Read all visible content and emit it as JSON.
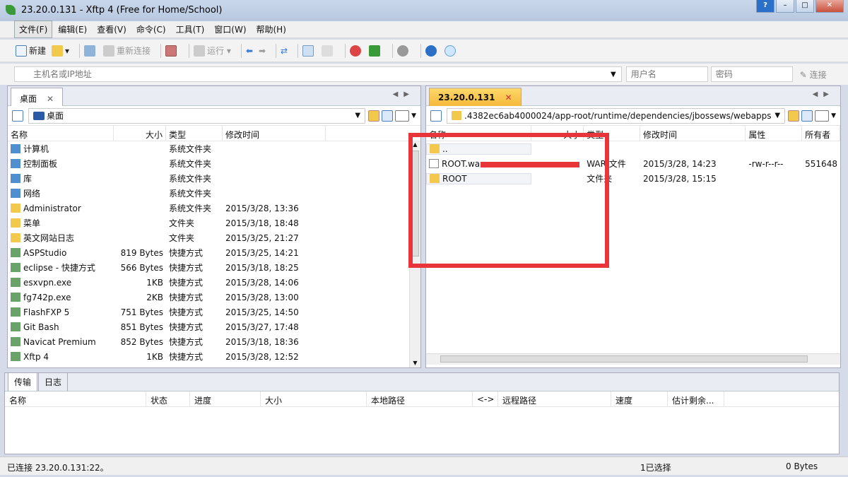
{
  "window": {
    "title": "23.20.0.131 - Xftp 4 (Free for Home/School)"
  },
  "menu": [
    "文件(F)",
    "编辑(E)",
    "查看(V)",
    "命令(C)",
    "工具(T)",
    "窗口(W)",
    "帮助(H)"
  ],
  "toolbar": {
    "new": "新建",
    "reconnect": "重新连接",
    "run": "运行"
  },
  "address": {
    "host_placeholder": "主机名或IP地址",
    "user_placeholder": "用户名",
    "password_placeholder": "密码",
    "connect": "连接"
  },
  "left": {
    "tab": "桌面",
    "path": "桌面",
    "columns": [
      "名称",
      "大小",
      "类型",
      "修改时间"
    ],
    "rows": [
      {
        "name": "计算机",
        "size": "",
        "type": "系统文件夹",
        "time": "",
        "icon": "sys"
      },
      {
        "name": "控制面板",
        "size": "",
        "type": "系统文件夹",
        "time": "",
        "icon": "sys"
      },
      {
        "name": "库",
        "size": "",
        "type": "系统文件夹",
        "time": "",
        "icon": "sys"
      },
      {
        "name": "网络",
        "size": "",
        "type": "系统文件夹",
        "time": "",
        "icon": "sys"
      },
      {
        "name": "Administrator",
        "size": "",
        "type": "系统文件夹",
        "time": "2015/3/28, 13:36",
        "icon": "folder"
      },
      {
        "name": "菜单",
        "size": "",
        "type": "文件夹",
        "time": "2015/3/18, 18:48",
        "icon": "folder"
      },
      {
        "name": "英文网站日志",
        "size": "",
        "type": "文件夹",
        "time": "2015/3/25, 21:27",
        "icon": "folder"
      },
      {
        "name": "ASPStudio",
        "size": "819 Bytes",
        "type": "快捷方式",
        "time": "2015/3/25, 14:21",
        "icon": "sc"
      },
      {
        "name": "eclipse - 快捷方式",
        "size": "566 Bytes",
        "type": "快捷方式",
        "time": "2015/3/18, 18:25",
        "icon": "sc"
      },
      {
        "name": "esxvpn.exe",
        "size": "1KB",
        "type": "快捷方式",
        "time": "2015/3/28, 14:06",
        "icon": "sc"
      },
      {
        "name": "fg742p.exe",
        "size": "2KB",
        "type": "快捷方式",
        "time": "2015/3/28, 13:00",
        "icon": "sc"
      },
      {
        "name": "FlashFXP 5",
        "size": "751 Bytes",
        "type": "快捷方式",
        "time": "2015/3/25, 14:50",
        "icon": "sc"
      },
      {
        "name": "Git Bash",
        "size": "851 Bytes",
        "type": "快捷方式",
        "time": "2015/3/27, 17:48",
        "icon": "sc"
      },
      {
        "name": "Navicat Premium",
        "size": "852 Bytes",
        "type": "快捷方式",
        "time": "2015/3/18, 18:36",
        "icon": "sc"
      },
      {
        "name": "Xftp 4",
        "size": "1KB",
        "type": "快捷方式",
        "time": "2015/3/28, 12:52",
        "icon": "sc"
      }
    ]
  },
  "right": {
    "tab": "23.20.0.131",
    "path": ".4382ec6ab4000024/app-root/runtime/dependencies/jbossews/webapps",
    "columns": [
      "名称",
      "大小",
      "类型",
      "修改时间",
      "属性",
      "所有者"
    ],
    "rows": [
      {
        "name": "..",
        "size": "",
        "type": "",
        "time": "",
        "attr": "",
        "owner": "",
        "icon": "folder"
      },
      {
        "name": "ROOT.war",
        "size": "",
        "type": "WAR 文件",
        "time": "2015/3/28, 14:23",
        "attr": "-rw-r--r--",
        "owner": "551648",
        "icon": "file"
      },
      {
        "name": "ROOT",
        "size": "",
        "type": "文件夹",
        "time": "2015/3/28, 15:15",
        "attr": "",
        "owner": "",
        "icon": "folder"
      }
    ]
  },
  "transfer": {
    "tabs": [
      "传输",
      "日志"
    ],
    "columns": [
      "名称",
      "状态",
      "进度",
      "大小",
      "本地路径",
      "<->",
      "远程路径",
      "速度",
      "估计剩余..."
    ]
  },
  "status": {
    "left": "已连接 23.20.0.131:22。",
    "mid": "1已选择",
    "right": "0 Bytes"
  }
}
